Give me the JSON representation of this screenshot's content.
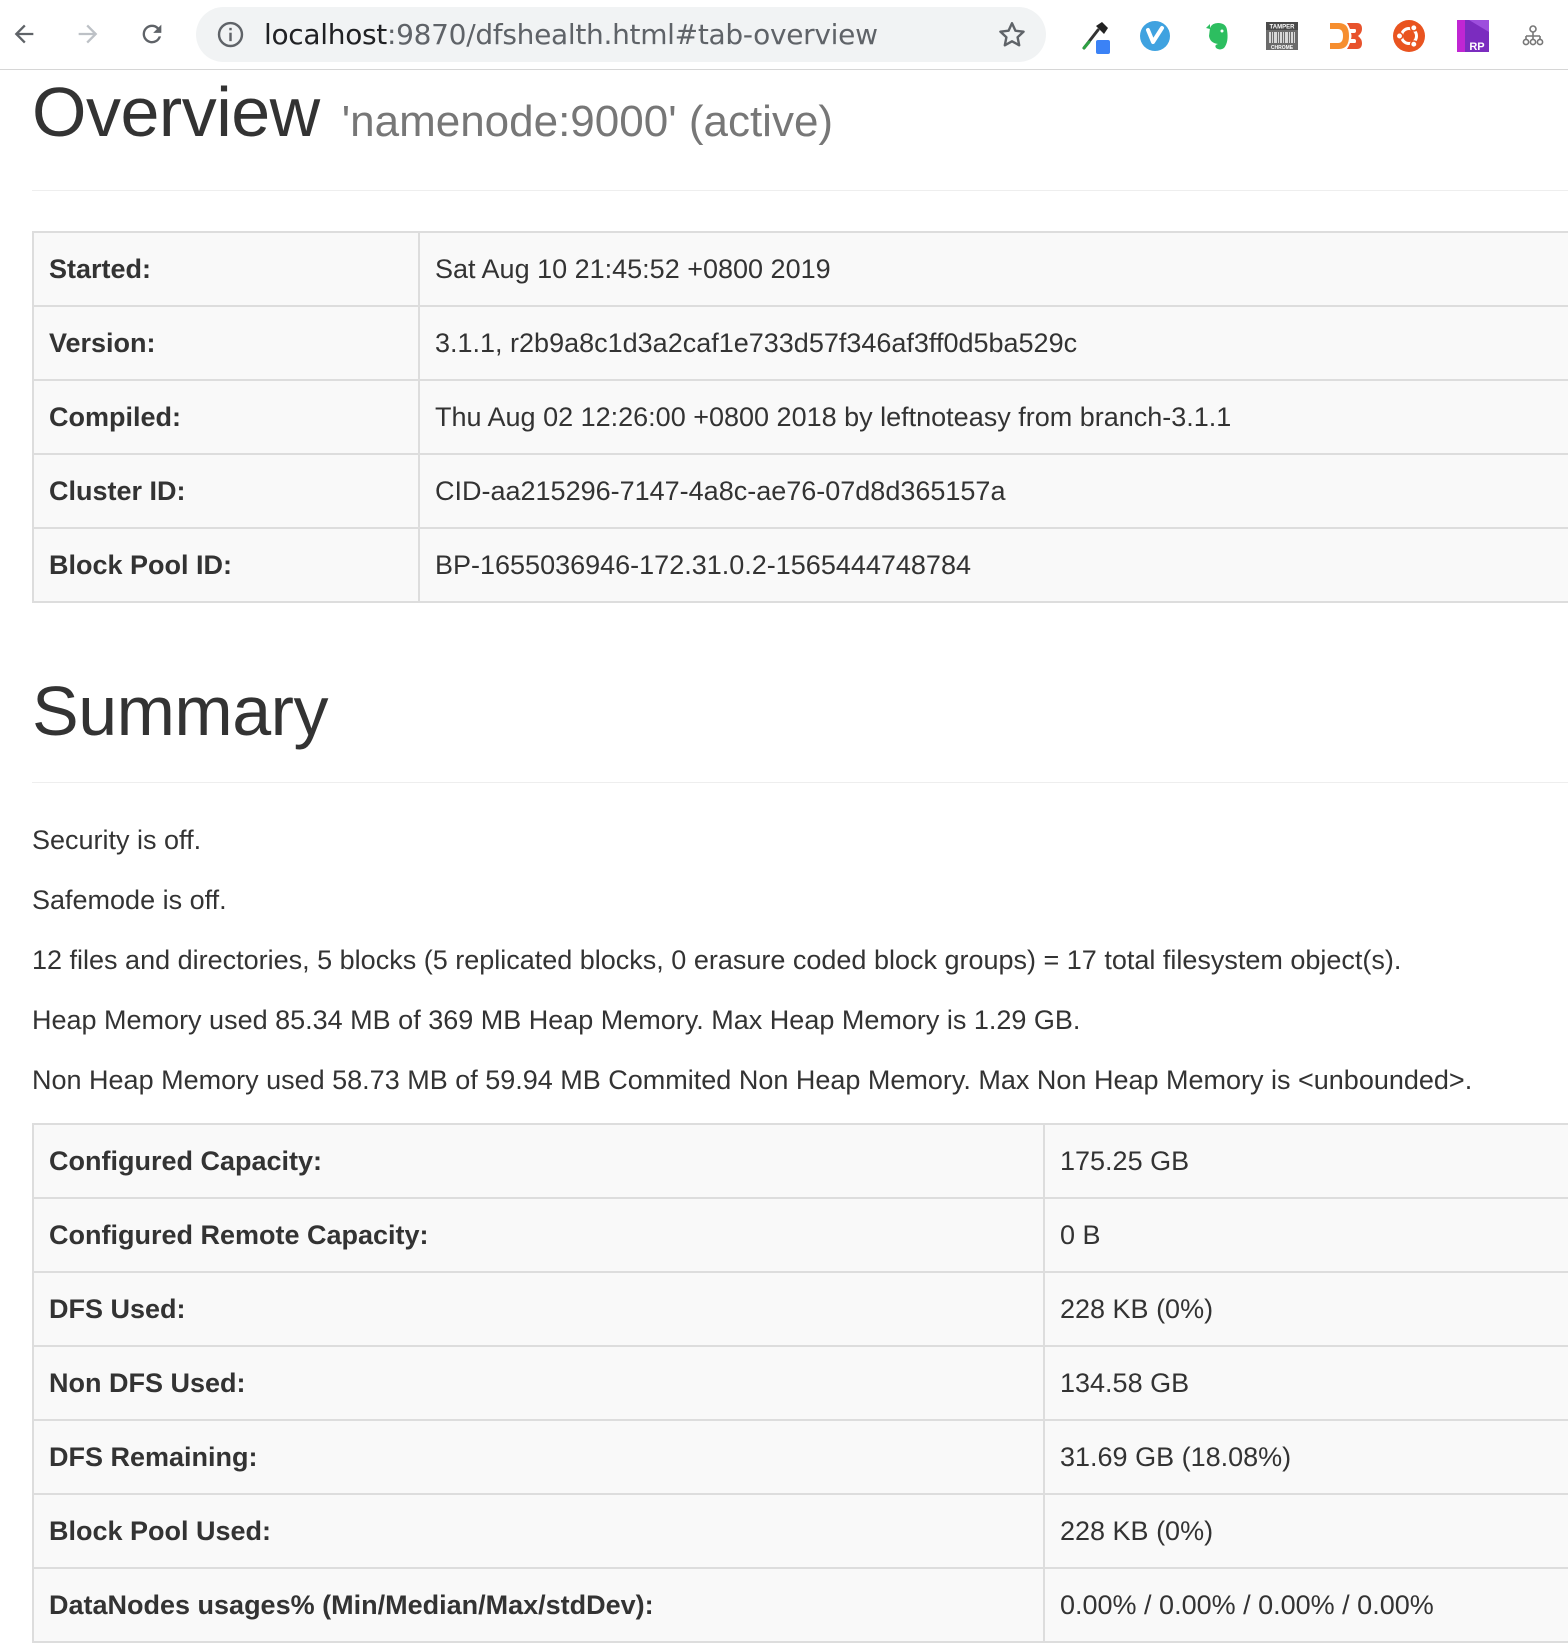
{
  "browser": {
    "url_host": "localhost",
    "url_rest": ":9870/dfshealth.html#tab-overview",
    "extensions": [
      "eyedropper-icon",
      "vimium-icon",
      "evernote-icon",
      "tamper-chrome-icon",
      "d3-icon",
      "ubuntu-icon",
      "rp-icon",
      "sitemap-icon"
    ],
    "extension_labels": {
      "tamper_top": "TAMPER",
      "tamper_bottom": "CHROME",
      "rp": "RP"
    }
  },
  "overview": {
    "title": "Overview",
    "subtitle": "'namenode:9000' (active)",
    "rows": [
      {
        "key": "Started:",
        "value": "Sat Aug 10 21:45:52 +0800 2019"
      },
      {
        "key": "Version:",
        "value": "3.1.1, r2b9a8c1d3a2caf1e733d57f346af3ff0d5ba529c"
      },
      {
        "key": "Compiled:",
        "value": "Thu Aug 02 12:26:00 +0800 2018 by leftnoteasy from branch-3.1.1"
      },
      {
        "key": "Cluster ID:",
        "value": "CID-aa215296-7147-4a8c-ae76-07d8d365157a"
      },
      {
        "key": "Block Pool ID:",
        "value": "BP-1655036946-172.31.0.2-1565444748784"
      }
    ]
  },
  "summary": {
    "title": "Summary",
    "lines": [
      "Security is off.",
      "Safemode is off.",
      "12 files and directories, 5 blocks (5 replicated blocks, 0 erasure coded block groups) = 17 total filesystem object(s).",
      "Heap Memory used 85.34 MB of 369 MB Heap Memory. Max Heap Memory is 1.29 GB.",
      "Non Heap Memory used 58.73 MB of 59.94 MB Commited Non Heap Memory. Max Non Heap Memory is <unbounded>."
    ],
    "rows": [
      {
        "key": "Configured Capacity:",
        "value": "175.25 GB"
      },
      {
        "key": "Configured Remote Capacity:",
        "value": "0 B"
      },
      {
        "key": "DFS Used:",
        "value": "228 KB (0%)"
      },
      {
        "key": "Non DFS Used:",
        "value": "134.58 GB"
      },
      {
        "key": "DFS Remaining:",
        "value": "31.69 GB (18.08%)"
      },
      {
        "key": "Block Pool Used:",
        "value": "228 KB (0%)"
      },
      {
        "key": "DataNodes usages% (Min/Median/Max/stdDev):",
        "value": "0.00% / 0.00% / 0.00% / 0.00%"
      }
    ]
  }
}
